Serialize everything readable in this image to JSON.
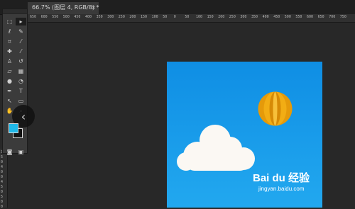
{
  "document_tab": {
    "title": "66.7% (图层 4, RGB/8) *",
    "close": "×"
  },
  "ruler": {
    "top_ticks": [
      "650",
      "600",
      "550",
      "500",
      "450",
      "400",
      "350",
      "300",
      "250",
      "200",
      "150",
      "100",
      "50",
      "0",
      "50",
      "100",
      "150",
      "200",
      "250",
      "300",
      "350",
      "400",
      "450",
      "500",
      "550",
      "600",
      "650",
      "700",
      "750"
    ],
    "left_ticks": [
      "3",
      "5",
      "0",
      "4",
      "0",
      "0",
      "4",
      "5",
      "0",
      "5",
      "0",
      "0"
    ]
  },
  "tools": [
    {
      "id": "marquee",
      "icon": "rect-marquee-icon",
      "glyph": "⬚"
    },
    {
      "id": "move",
      "icon": "move-icon",
      "glyph": "▸"
    },
    {
      "id": "lasso",
      "icon": "lasso-icon",
      "glyph": "ℓ"
    },
    {
      "id": "quick-select",
      "icon": "quick-select-icon",
      "glyph": "✎"
    },
    {
      "id": "crop",
      "icon": "crop-icon",
      "glyph": "⌗"
    },
    {
      "id": "eyedropper",
      "icon": "eyedropper-icon",
      "glyph": "⁄"
    },
    {
      "id": "healing",
      "icon": "healing-icon",
      "glyph": "✚"
    },
    {
      "id": "brush",
      "icon": "brush-icon",
      "glyph": "⁄"
    },
    {
      "id": "stamp",
      "icon": "stamp-icon",
      "glyph": "♙"
    },
    {
      "id": "history-brush",
      "icon": "history-brush-icon",
      "glyph": "↺"
    },
    {
      "id": "eraser",
      "icon": "eraser-icon",
      "glyph": "▱"
    },
    {
      "id": "gradient",
      "icon": "gradient-icon",
      "glyph": "▦"
    },
    {
      "id": "blur",
      "icon": "blur-icon",
      "glyph": "●"
    },
    {
      "id": "dodge",
      "icon": "dodge-icon",
      "glyph": "◔"
    },
    {
      "id": "pen",
      "icon": "pen-icon",
      "glyph": "✒"
    },
    {
      "id": "type",
      "icon": "type-icon",
      "glyph": "T"
    },
    {
      "id": "path-select",
      "icon": "path-select-icon",
      "glyph": "↖"
    },
    {
      "id": "shape",
      "icon": "shape-icon",
      "glyph": "▭"
    },
    {
      "id": "hand",
      "icon": "hand-icon",
      "glyph": "✋"
    },
    {
      "id": "zoom",
      "icon": "zoom-icon",
      "glyph": "⌕"
    },
    {
      "id": "quick-mask",
      "icon": "quick-mask-icon",
      "glyph": "◙"
    },
    {
      "id": "screen-mode",
      "icon": "screen-mode-icon",
      "glyph": "▣"
    }
  ],
  "colors": {
    "foreground": "#1fb8e8",
    "background": "#111111",
    "canvas_top": "#0f8ee4",
    "canvas_bottom": "#22a8ef"
  },
  "collapse_button": {
    "glyph": "‹"
  },
  "watermark": {
    "logo_text": "Bai du 经验",
    "url": "jingyan.baidu.com"
  }
}
